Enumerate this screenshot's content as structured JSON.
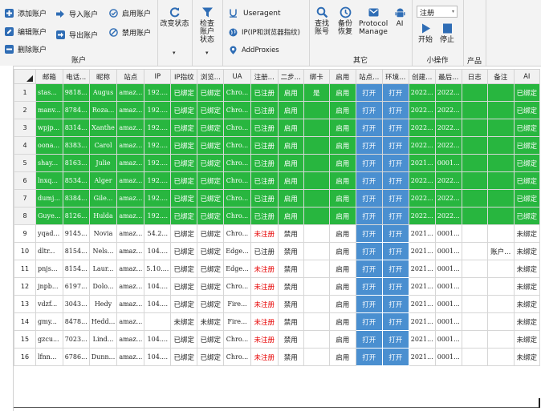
{
  "ribbon": {
    "account": {
      "add": "添加账户",
      "edit": "编辑账户",
      "delete": "删除账户",
      "import": "导入账户",
      "export": "导出账户",
      "enable": "启用账户",
      "disable": "禁用账户",
      "group_label": "账户"
    },
    "change_status": "改变状态",
    "check_status": "检查账户状态",
    "useragent": "Useragent",
    "ip_fingerprint": "IP(IP和浏览器指纹)",
    "add_proxies": "AddProxies",
    "find_account": "查找账号",
    "backup_restore": "备份恢复",
    "protocol_manage": "Protocol Manage",
    "ai": "AI",
    "other_label": "其它",
    "register_select": "注册",
    "start": "开始",
    "stop": "停止",
    "small_ops_label": "小操作",
    "product_label": "产品"
  },
  "table": {
    "columns": [
      "",
      "邮箱",
      "电话...",
      "昵称",
      "站点",
      "IP",
      "IP指纹",
      "浏览...",
      "UA",
      "注册...",
      "二步...",
      "绑卡",
      "启用",
      "站点...",
      "环境...",
      "创建...",
      "最后...",
      "日志",
      "备注",
      "AI"
    ],
    "rows": [
      {
        "n": "1",
        "email": "stas...",
        "phone": "9818...",
        "nick": "Augus",
        "site": "amaz...",
        "ip": "192....",
        "ipfp": "已绑定",
        "browser": "已绑定",
        "ua": "Chro...",
        "reg": "已注册",
        "twostep": "启用",
        "card": "是",
        "enabled": "启用",
        "site_btn": "打开",
        "env_btn": "打开",
        "created": "2022...",
        "last": "2022...",
        "log": "",
        "note": "",
        "ai": "已绑定",
        "green": true
      },
      {
        "n": "2",
        "email": "manv...",
        "phone": "8784...",
        "nick": "Roza...",
        "site": "amaz...",
        "ip": "192....",
        "ipfp": "已绑定",
        "browser": "已绑定",
        "ua": "Chro...",
        "reg": "已注册",
        "twostep": "启用",
        "card": "",
        "enabled": "启用",
        "site_btn": "打开",
        "env_btn": "打开",
        "created": "2022...",
        "last": "2022...",
        "log": "",
        "note": "",
        "ai": "已绑定",
        "green": true
      },
      {
        "n": "3",
        "email": "wpjp...",
        "phone": "8314...",
        "nick": "Xanthe",
        "site": "amaz...",
        "ip": "192....",
        "ipfp": "已绑定",
        "browser": "已绑定",
        "ua": "Chro...",
        "reg": "已注册",
        "twostep": "启用",
        "card": "",
        "enabled": "启用",
        "site_btn": "打开",
        "env_btn": "打开",
        "created": "2022...",
        "last": "2022...",
        "log": "",
        "note": "",
        "ai": "已绑定",
        "green": true
      },
      {
        "n": "4",
        "email": "oona...",
        "phone": "8383...",
        "nick": "Carol",
        "site": "amaz...",
        "ip": "192....",
        "ipfp": "已绑定",
        "browser": "已绑定",
        "ua": "Chro...",
        "reg": "已注册",
        "twostep": "启用",
        "card": "",
        "enabled": "启用",
        "site_btn": "打开",
        "env_btn": "打开",
        "created": "2022...",
        "last": "2022...",
        "log": "",
        "note": "",
        "ai": "已绑定",
        "green": true
      },
      {
        "n": "5",
        "email": "shay...",
        "phone": "8163...",
        "nick": "Julie",
        "site": "amaz...",
        "ip": "192....",
        "ipfp": "已绑定",
        "browser": "已绑定",
        "ua": "Chro...",
        "reg": "已注册",
        "twostep": "启用",
        "card": "",
        "enabled": "启用",
        "site_btn": "打开",
        "env_btn": "打开",
        "created": "2021...",
        "last": "0001...",
        "log": "",
        "note": "",
        "ai": "已绑定",
        "green": true
      },
      {
        "n": "6",
        "email": "lnxq...",
        "phone": "8534...",
        "nick": "Alger",
        "site": "amaz...",
        "ip": "192....",
        "ipfp": "已绑定",
        "browser": "已绑定",
        "ua": "Chro...",
        "reg": "已注册",
        "twostep": "启用",
        "card": "",
        "enabled": "启用",
        "site_btn": "打开",
        "env_btn": "打开",
        "created": "2022...",
        "last": "2022...",
        "log": "",
        "note": "",
        "ai": "已绑定",
        "green": true
      },
      {
        "n": "7",
        "email": "dumj...",
        "phone": "8384...",
        "nick": "Gile...",
        "site": "amaz...",
        "ip": "192....",
        "ipfp": "已绑定",
        "browser": "已绑定",
        "ua": "Chro...",
        "reg": "已注册",
        "twostep": "启用",
        "card": "",
        "enabled": "启用",
        "site_btn": "打开",
        "env_btn": "打开",
        "created": "2022...",
        "last": "2022...",
        "log": "",
        "note": "",
        "ai": "已绑定",
        "green": true
      },
      {
        "n": "8",
        "email": "Guye...",
        "phone": "8126...",
        "nick": "Hulda",
        "site": "amaz...",
        "ip": "192....",
        "ipfp": "已绑定",
        "browser": "已绑定",
        "ua": "Chro...",
        "reg": "已注册",
        "twostep": "启用",
        "card": "",
        "enabled": "启用",
        "site_btn": "打开",
        "env_btn": "打开",
        "created": "2022...",
        "last": "2022...",
        "log": "",
        "note": "",
        "ai": "已绑定",
        "green": true
      },
      {
        "n": "9",
        "email": "yqad...",
        "phone": "9145...",
        "nick": "Novia",
        "site": "amaz...",
        "ip": "54.2...",
        "ipfp": "已绑定",
        "browser": "已绑定",
        "ua": "Chro...",
        "reg": "未注册",
        "twostep": "禁用",
        "card": "",
        "enabled": "启用",
        "site_btn": "打开",
        "env_btn": "打开",
        "created": "2021...",
        "last": "0001...",
        "log": "",
        "note": "",
        "ai": "未绑定",
        "green": false
      },
      {
        "n": "10",
        "email": "dltr...",
        "phone": "8154...",
        "nick": "Nels...",
        "site": "amaz...",
        "ip": "104....",
        "ipfp": "已绑定",
        "browser": "已绑定",
        "ua": "Edge...",
        "reg": "已注册",
        "twostep": "禁用",
        "card": "",
        "enabled": "启用",
        "site_btn": "打开",
        "env_btn": "打开",
        "created": "2021...",
        "last": "0001...",
        "log": "",
        "note": "账户...",
        "ai": "未绑定",
        "green": false
      },
      {
        "n": "11",
        "email": "pnjs...",
        "phone": "8154...",
        "nick": "Laur...",
        "site": "amaz...",
        "ip": "5.10....",
        "ipfp": "已绑定",
        "browser": "已绑定",
        "ua": "Edge...",
        "reg": "未注册",
        "twostep": "禁用",
        "card": "",
        "enabled": "启用",
        "site_btn": "打开",
        "env_btn": "打开",
        "created": "2021...",
        "last": "0001...",
        "log": "",
        "note": "",
        "ai": "未绑定",
        "green": false
      },
      {
        "n": "12",
        "email": "jnpb...",
        "phone": "6197...",
        "nick": "Dolo...",
        "site": "amaz...",
        "ip": "104....",
        "ipfp": "已绑定",
        "browser": "已绑定",
        "ua": "Chro...",
        "reg": "未注册",
        "twostep": "禁用",
        "card": "",
        "enabled": "启用",
        "site_btn": "打开",
        "env_btn": "打开",
        "created": "2021...",
        "last": "0001...",
        "log": "",
        "note": "",
        "ai": "未绑定",
        "green": false
      },
      {
        "n": "13",
        "email": "vdzf...",
        "phone": "3043...",
        "nick": "Hedy",
        "site": "amaz...",
        "ip": "104....",
        "ipfp": "已绑定",
        "browser": "已绑定",
        "ua": "Fire...",
        "reg": "未注册",
        "twostep": "禁用",
        "card": "",
        "enabled": "启用",
        "site_btn": "打开",
        "env_btn": "打开",
        "created": "2021...",
        "last": "0001...",
        "log": "",
        "note": "",
        "ai": "未绑定",
        "green": false
      },
      {
        "n": "14",
        "email": "gmy...",
        "phone": "8478...",
        "nick": "Hedd...",
        "site": "amaz...",
        "ip": "",
        "ipfp": "未绑定",
        "browser": "未绑定",
        "ua": "Fire...",
        "reg": "未注册",
        "twostep": "禁用",
        "card": "",
        "enabled": "启用",
        "site_btn": "打开",
        "env_btn": "打开",
        "created": "2021...",
        "last": "0001...",
        "log": "",
        "note": "",
        "ai": "未绑定",
        "green": false
      },
      {
        "n": "15",
        "email": "gzcu...",
        "phone": "7023...",
        "nick": "Lind...",
        "site": "amaz...",
        "ip": "104....",
        "ipfp": "已绑定",
        "browser": "已绑定",
        "ua": "Chro...",
        "reg": "未注册",
        "twostep": "禁用",
        "card": "",
        "enabled": "启用",
        "site_btn": "打开",
        "env_btn": "打开",
        "created": "2021...",
        "last": "0001...",
        "log": "",
        "note": "",
        "ai": "未绑定",
        "green": false
      },
      {
        "n": "16",
        "email": "lfnn...",
        "phone": "6786...",
        "nick": "Dunn...",
        "site": "amaz...",
        "ip": "104....",
        "ipfp": "已绑定",
        "browser": "已绑定",
        "ua": "Chro...",
        "reg": "未注册",
        "twostep": "禁用",
        "card": "",
        "enabled": "启用",
        "site_btn": "打开",
        "env_btn": "打开",
        "created": "2021...",
        "last": "0001...",
        "log": "",
        "note": "",
        "ai": "未绑定",
        "green": false
      }
    ]
  },
  "colors": {
    "green": "#28b63f",
    "button_blue": "#4a8fd0",
    "red": "#e60000",
    "accent": "#2f6db5"
  }
}
